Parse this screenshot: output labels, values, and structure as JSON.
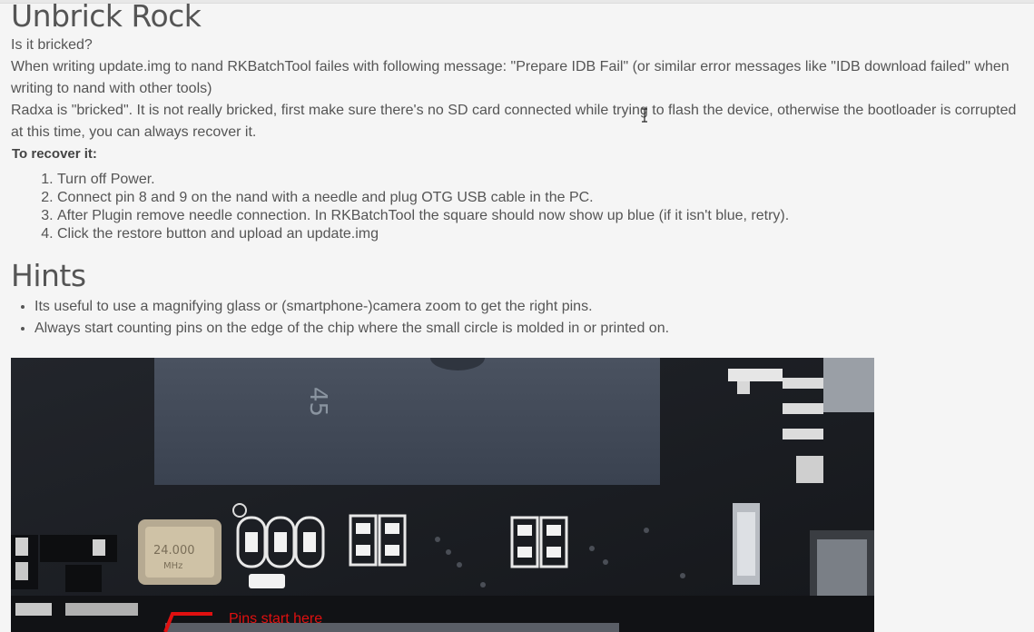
{
  "section1": {
    "title": "Unbrick Rock",
    "paragraphs": [
      "Is it bricked?",
      "When writing update.img to nand RKBatchTool failes with following message: \"Prepare IDB Fail\" (or similar error messages like \"IDB download failed\" when writing to nand with other tools)",
      "Radxa is \"bricked\". It is not really bricked, first make sure there's no SD card connected while trying to flash the device, otherwise the bootloader is corrupted at this time, you can always recover it."
    ],
    "recover_heading": "To recover it:",
    "steps": [
      "Turn off Power.",
      "Connect pin 8 and 9 on the nand with a needle and plug OTG USB cable in the PC.",
      "After Plugin remove needle connection. In RKBatchTool the square should now show up blue (if it isn't blue, retry).",
      "Click the restore button and upload an update.img"
    ]
  },
  "section2": {
    "title": "Hints",
    "items": [
      "Its useful to use a magnifying glass or (smartphone-)camera zoom to get the right pins.",
      "Always start counting pins on the edge of the chip where the small circle is molded in or printed on."
    ]
  },
  "photo": {
    "chip_marking": "45",
    "crystal_label_line1": "24.000",
    "crystal_label_line2": "MHz",
    "annotation": "Pins start here",
    "annotation_color": "#e01010"
  }
}
